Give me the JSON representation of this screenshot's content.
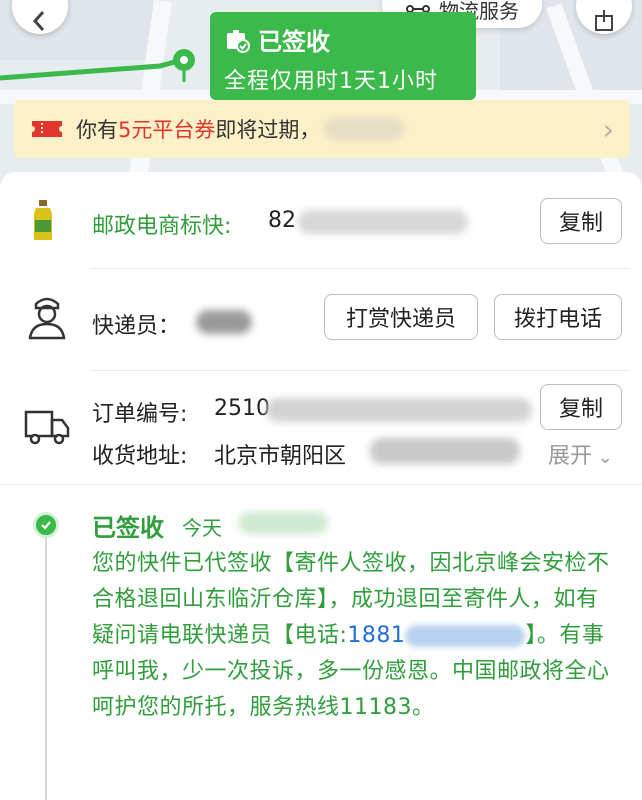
{
  "status": {
    "title": "已签收",
    "subtitle": "全程仅用时1天1小时"
  },
  "top": {
    "logistics_label": "物流服务"
  },
  "coupon": {
    "prefix": "你有",
    "amount": "5元平台券",
    "suffix": "即将过期，"
  },
  "courier_company": {
    "name": "邮政电商标快:",
    "tracking_prefix": "82",
    "copy_label": "复制"
  },
  "courier": {
    "label": "快递员：",
    "tip_label": "打赏快递员",
    "call_label": "拨打电话"
  },
  "order": {
    "label": "订单编号:",
    "number_prefix": "2510",
    "copy_label": "复制",
    "address_label": "收货地址:",
    "address_prefix": "北京市朝阳区",
    "expand_label": "展开"
  },
  "event": {
    "title": "已签收",
    "time_prefix": "今天",
    "body_1": "您的快件已代签收【寄件人签收，因北京峰会安检不合格退回山东临沂仓库】，成功退回至寄件人，如有疑问请电联快递员【电话:",
    "phone_prefix": "1881",
    "body_2": "】。有事呼叫我，少一次投诉，多一份感恩。中国邮政将全心呵护您的所托，服务热线11183。"
  },
  "colors": {
    "brand_green": "#3bb94a",
    "text_green": "#2f9e3b",
    "coupon_red": "#e0362d",
    "link_blue": "#1f6fd6"
  },
  "icons": [
    "back-icon",
    "share-icon",
    "route-icon",
    "package-check-icon",
    "ticket-icon",
    "bottle-product-icon",
    "courier-person-icon",
    "truck-icon",
    "check-icon",
    "chevron-right-icon",
    "chevron-down-icon"
  ]
}
